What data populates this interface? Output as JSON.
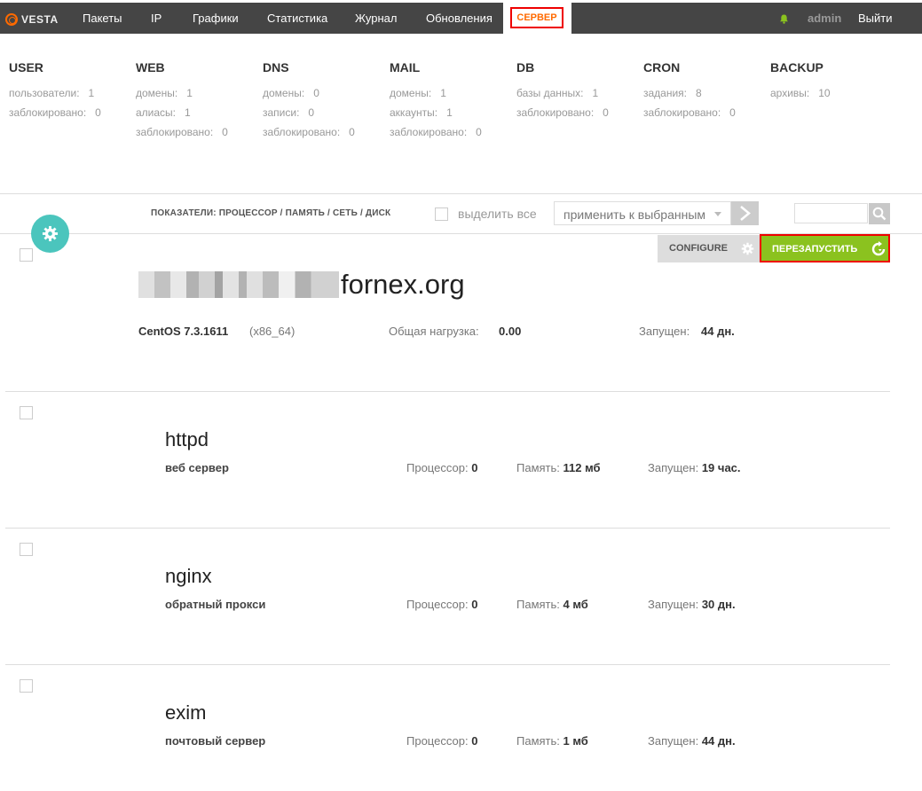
{
  "nav": {
    "logo": "VESTA",
    "items": [
      "Пакеты",
      "IP",
      "Графики",
      "Статистика",
      "Журнал",
      "Обновления"
    ],
    "active": "СЕРВЕР",
    "user": "admin",
    "logout": "Выйти",
    "accent": "#ff6a00"
  },
  "stats": {
    "user": {
      "title": "USER",
      "rows": [
        {
          "label": "пользователи:",
          "value": "1"
        },
        {
          "label": "заблокировано:",
          "value": "0"
        }
      ]
    },
    "web": {
      "title": "WEB",
      "rows": [
        {
          "label": "домены:",
          "value": "1"
        },
        {
          "label": "алиасы:",
          "value": "1"
        },
        {
          "label": "заблокировано:",
          "value": "0"
        }
      ]
    },
    "dns": {
      "title": "DNS",
      "rows": [
        {
          "label": "домены:",
          "value": "0"
        },
        {
          "label": "записи:",
          "value": "0"
        },
        {
          "label": "заблокировано:",
          "value": "0"
        }
      ]
    },
    "mail": {
      "title": "MAIL",
      "rows": [
        {
          "label": "домены:",
          "value": "1"
        },
        {
          "label": "аккаунты:",
          "value": "1"
        },
        {
          "label": "заблокировано:",
          "value": "0"
        }
      ]
    },
    "db": {
      "title": "DB",
      "rows": [
        {
          "label": "базы данных:",
          "value": "1"
        },
        {
          "label": "заблокировано:",
          "value": "0"
        }
      ]
    },
    "cron": {
      "title": "CRON",
      "rows": [
        {
          "label": "задания:",
          "value": "8"
        },
        {
          "label": "заблокировано:",
          "value": "0"
        }
      ]
    },
    "backup": {
      "title": "BACKUP",
      "rows": [
        {
          "label": "архивы:",
          "value": "10"
        }
      ]
    }
  },
  "toolbar": {
    "metrics": "ПОКАЗАТЕЛИ: ПРОЦЕССОР / ПАМЯТЬ / СЕТЬ / ДИСК",
    "select_all": "выделить все",
    "apply": "применить к выбранным",
    "search_placeholder": ""
  },
  "server": {
    "hostname": "fornex.org",
    "os": "CentOS 7.3.1611",
    "arch": "(x86_64)",
    "load_label": "Общая нагрузка:",
    "load": "0.00",
    "uptime_label": "Запущен:",
    "uptime": "44 дн.",
    "configure": "CONFIGURE",
    "restart": "ПЕРЕЗАПУСТИТЬ",
    "restart_color": "#8bc21f"
  },
  "services": [
    {
      "name": "httpd",
      "desc": "веб сервер",
      "cpu_label": "Процессор:",
      "cpu": "0",
      "mem_label": "Память:",
      "mem": "112 мб",
      "up_label": "Запущен:",
      "up": "19 час."
    },
    {
      "name": "nginx",
      "desc": "обратный прокси",
      "cpu_label": "Процессор:",
      "cpu": "0",
      "mem_label": "Память:",
      "mem": "4 мб",
      "up_label": "Запущен:",
      "up": "30 дн."
    },
    {
      "name": "exim",
      "desc": "почтовый сервер",
      "cpu_label": "Процессор:",
      "cpu": "0",
      "mem_label": "Память:",
      "mem": "1 мб",
      "up_label": "Запущен:",
      "up": "44 дн."
    }
  ]
}
